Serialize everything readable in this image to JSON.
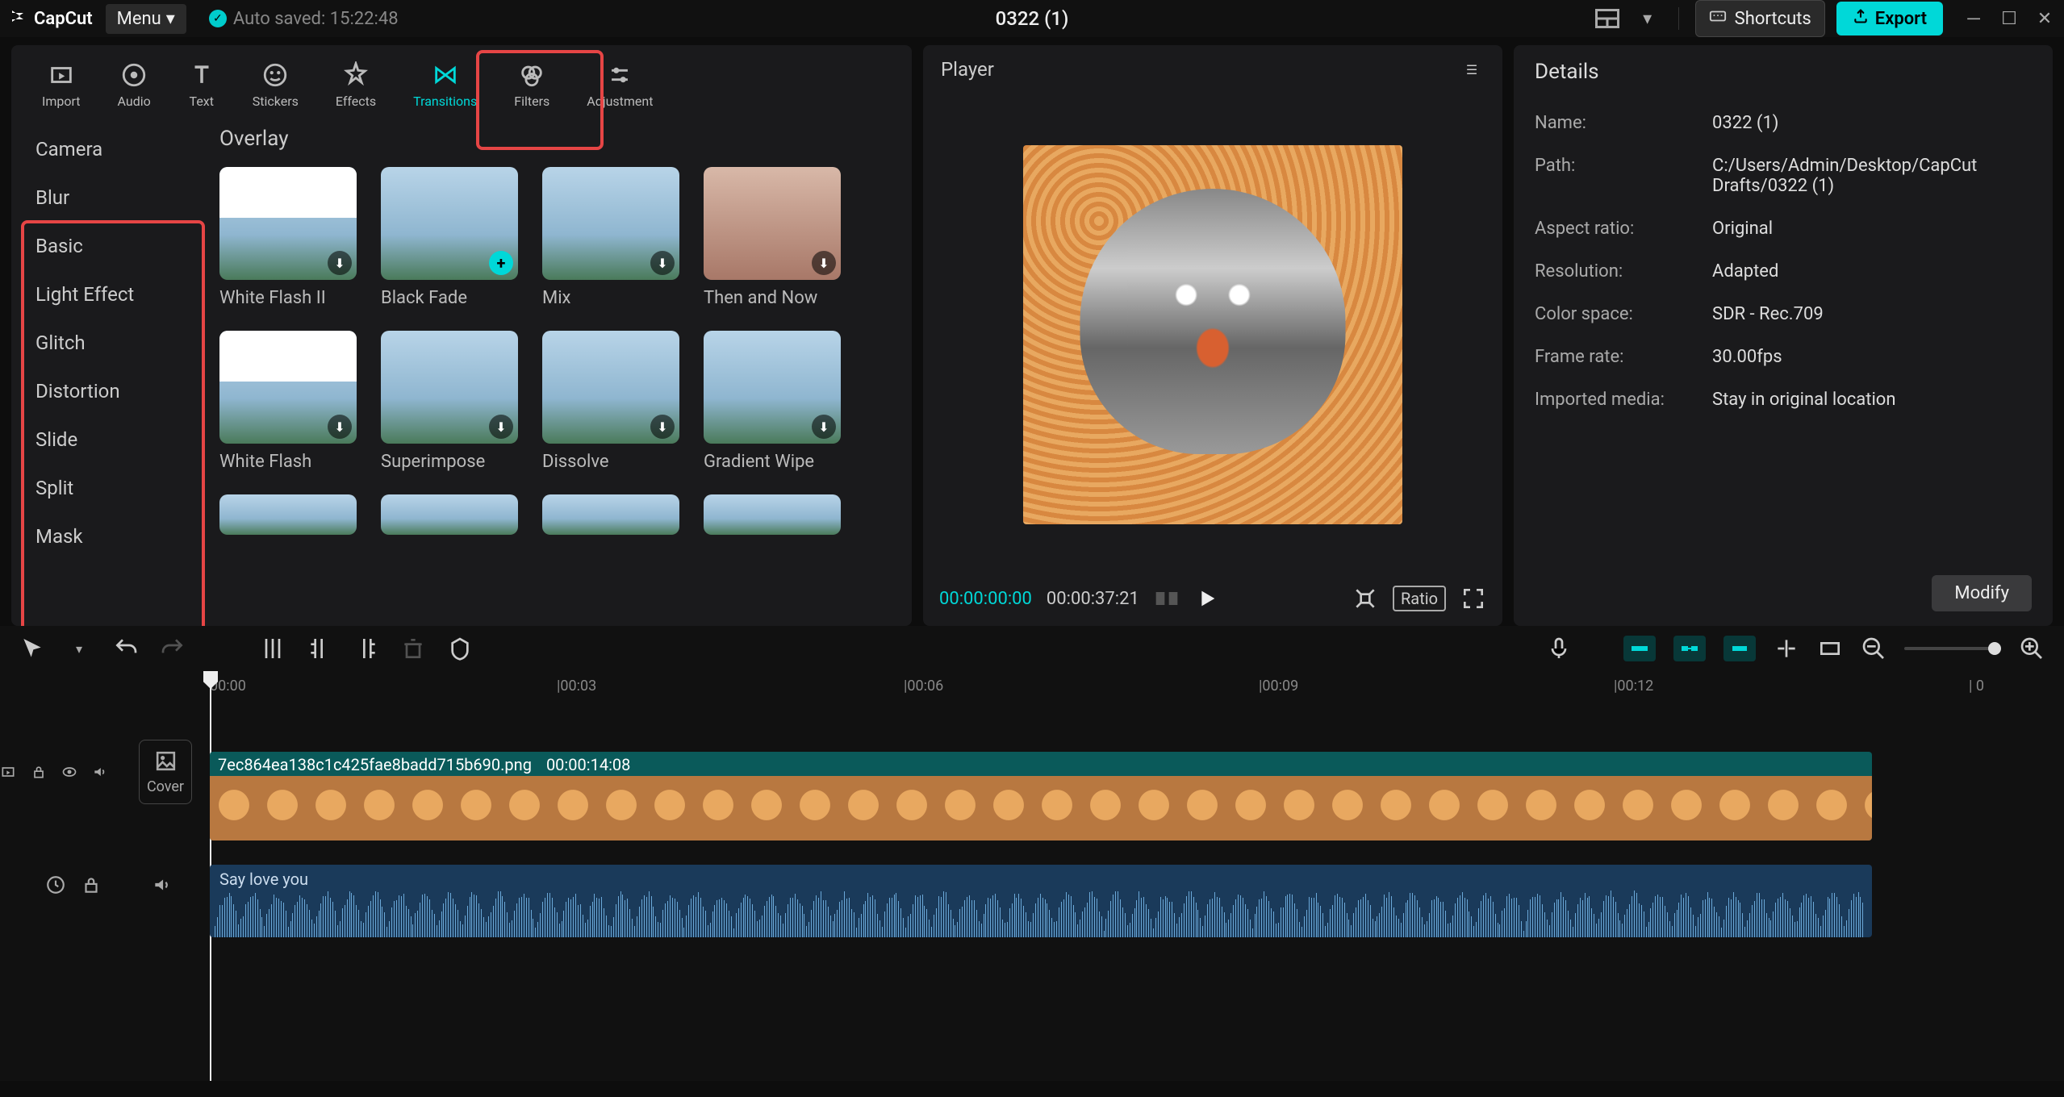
{
  "app": {
    "name": "CapCut",
    "menu_label": "Menu",
    "autosave_text": "Auto saved: 15:22:48",
    "project_title": "0322 (1)"
  },
  "titlebar": {
    "shortcuts_label": "Shortcuts",
    "export_label": "Export"
  },
  "tabs": [
    {
      "id": "import",
      "label": "Import"
    },
    {
      "id": "audio",
      "label": "Audio"
    },
    {
      "id": "text",
      "label": "Text"
    },
    {
      "id": "stickers",
      "label": "Stickers"
    },
    {
      "id": "effects",
      "label": "Effects"
    },
    {
      "id": "transitions",
      "label": "Transitions"
    },
    {
      "id": "filters",
      "label": "Filters"
    },
    {
      "id": "adjustment",
      "label": "Adjustment"
    }
  ],
  "active_tab": "transitions",
  "categories": [
    "Camera",
    "Blur",
    "Basic",
    "Light Effect",
    "Glitch",
    "Distortion",
    "Slide",
    "Split",
    "Mask"
  ],
  "overlay": {
    "title": "Overlay",
    "items": [
      {
        "label": "White Flash II",
        "badge": "download",
        "style": "white-top"
      },
      {
        "label": "Black Fade",
        "badge": "add",
        "style": ""
      },
      {
        "label": "Mix",
        "badge": "download",
        "style": ""
      },
      {
        "label": "Then and Now",
        "badge": "download",
        "style": "portrait"
      },
      {
        "label": "White Flash",
        "badge": "download",
        "style": "white-top"
      },
      {
        "label": "Superimpose",
        "badge": "download",
        "style": ""
      },
      {
        "label": "Dissolve",
        "badge": "download",
        "style": ""
      },
      {
        "label": "Gradient Wipe",
        "badge": "download",
        "style": ""
      }
    ]
  },
  "player": {
    "title": "Player",
    "current_time": "00:00:00:00",
    "total_time": "00:00:37:21",
    "ratio_label": "Ratio"
  },
  "details": {
    "title": "Details",
    "rows": [
      {
        "label": "Name:",
        "value": "0322 (1)"
      },
      {
        "label": "Path:",
        "value": "C:/Users/Admin/Desktop/CapCut Drafts/0322 (1)"
      },
      {
        "label": "Aspect ratio:",
        "value": "Original"
      },
      {
        "label": "Resolution:",
        "value": "Adapted"
      },
      {
        "label": "Color space:",
        "value": "SDR - Rec.709"
      },
      {
        "label": "Frame rate:",
        "value": "30.00fps"
      },
      {
        "label": "Imported media:",
        "value": "Stay in original location"
      }
    ],
    "modify_label": "Modify"
  },
  "timeline": {
    "ruler": [
      "00:00",
      "|00:03",
      "|00:06",
      "|00:09",
      "|00:12",
      "| 0"
    ],
    "cover_label": "Cover",
    "video_clip": {
      "filename": "7ec864ea138c1c425fae8badd715b690.png",
      "duration": "00:00:14:08"
    },
    "audio_clip": {
      "name": "Say love you"
    }
  }
}
